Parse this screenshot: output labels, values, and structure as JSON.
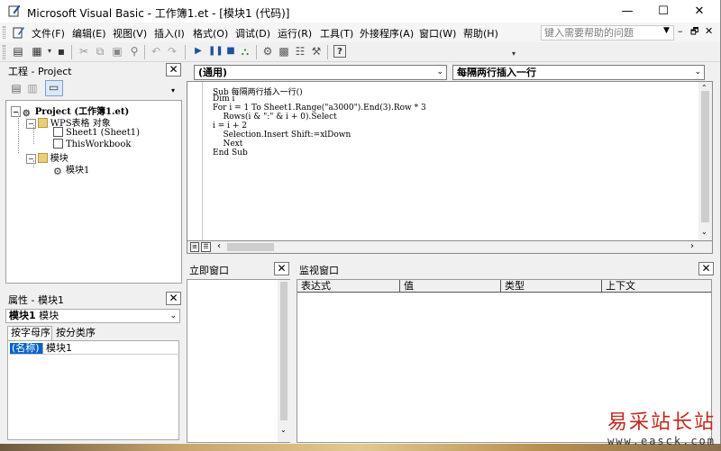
{
  "window": {
    "title": "Microsoft Visual Basic - 工作簿1.et - [模块1 (代码)]",
    "minimize": "—",
    "maximize": "☐",
    "close": "✕"
  },
  "menu": {
    "items": [
      "文件(F)",
      "编辑(E)",
      "视图(V)",
      "插入(I)",
      "格式(O)",
      "调试(D)",
      "运行(R)",
      "工具(T)",
      "外接程序(A)",
      "窗口(W)",
      "帮助(H)"
    ],
    "help_placeholder": "键入需要帮助的问题",
    "mdi_minimize": "–",
    "mdi_restore": "🗗",
    "mdi_close": "✕"
  },
  "toolbar": {
    "icons": [
      "view-host-icon",
      "insert-module-icon",
      "save-icon",
      "cut-icon",
      "copy-icon",
      "paste-icon",
      "find-icon",
      "undo-icon",
      "redo-icon",
      "run-icon",
      "break-icon",
      "reset-icon",
      "design-mode-icon",
      "project-explorer-icon",
      "properties-icon",
      "object-browser-icon",
      "toolbox-icon",
      "help-icon"
    ]
  },
  "project_panel": {
    "title": "工程 - Project",
    "close": "✕",
    "tree": [
      {
        "label": "Project (工作簿1.et)",
        "level": 0,
        "bold": true
      },
      {
        "label": "WPS表格 对象",
        "level": 1
      },
      {
        "label": "Sheet1 (Sheet1)",
        "level": 2
      },
      {
        "label": "ThisWorkbook",
        "level": 2
      },
      {
        "label": "模块",
        "level": 1
      },
      {
        "label": "模块1",
        "level": 2
      }
    ]
  },
  "properties_panel": {
    "title": "属性 - 模块1",
    "close": "✕",
    "object_name": "模块1",
    "object_type": "模块",
    "tabs": [
      "按字母序",
      "按分类序"
    ],
    "rows": [
      {
        "name": "(名称)",
        "value": "模块1"
      }
    ]
  },
  "code_window": {
    "object_combo": "(通用)",
    "proc_combo": "每隔两行插入一行",
    "lines": [
      "Sub 每隔两行插入一行()",
      "Dim i",
      "For i = 1 To Sheet1.Range(\"a3000\").End(3).Row * 3",
      "    Rows(i & \":\" & i + 0).Select",
      "i = i + 2",
      "    Selection.Insert Shift:=xlDown",
      "    Next",
      "End Sub"
    ]
  },
  "immediate_panel": {
    "title": "立即窗口",
    "close": "✕"
  },
  "watch_panel": {
    "title": "监视窗口",
    "close": "✕",
    "columns": [
      "表达式",
      "值",
      "类型",
      "上下文"
    ]
  },
  "watermark": {
    "text": "易采站长站",
    "url": "www.easck.com"
  },
  "colors": {
    "selection": "#0a64c8",
    "watermark": "#c0281e"
  }
}
